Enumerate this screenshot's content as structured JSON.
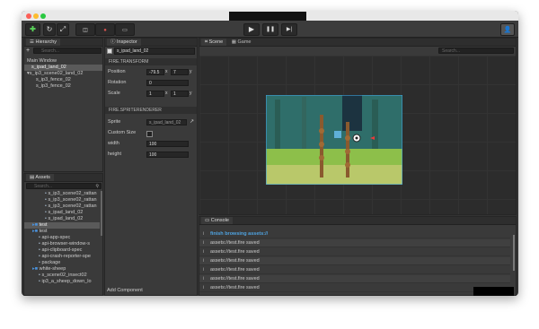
{
  "toolbar": {
    "play_icon": "▶",
    "pause_icon": "❚❚",
    "step_icon": "▶|"
  },
  "hierarchy": {
    "title": "Hierarchy",
    "search_placeholder": "Search...",
    "items": [
      {
        "label": "Main Window",
        "indent": 0
      },
      {
        "label": "s_ipad_land_02",
        "indent": 1,
        "selected": true
      },
      {
        "label": "s_ip3_scene02_land_02",
        "indent": 1,
        "expanded": true
      },
      {
        "label": "s_ip3_fence_02",
        "indent": 2
      },
      {
        "label": "s_ip3_fence_02",
        "indent": 2
      }
    ]
  },
  "inspector": {
    "title": "Inspector",
    "node_name": "s_ipad_land_02",
    "transform_header": "FIRE.TRANSFORM",
    "position_label": "Position",
    "position_x": "-79.5",
    "position_y": "7",
    "x_axis": "x",
    "y_axis": "y",
    "rotation_label": "Rotation",
    "rotation_value": "0",
    "scale_label": "Scale",
    "scale_x": "1",
    "scale_y": "1",
    "sprite_header": "FIRE.SPRITERENDERER",
    "sprite_label": "Sprite",
    "sprite_value": "s_ipad_land_02",
    "custom_size_label": "Custom Size",
    "width_label": "width",
    "width_value": "100",
    "height_label": "height",
    "height_value": "100",
    "add_component": "Add Component"
  },
  "scene": {
    "tab_scene": "Scene",
    "tab_game": "Game",
    "search_placeholder": "Search..."
  },
  "assets": {
    "title": "Assets",
    "search_placeholder": "Search...",
    "items": [
      {
        "label": "s_ip3_scene02_rattan",
        "indent": 3
      },
      {
        "label": "s_ip3_scene02_rattan",
        "indent": 3
      },
      {
        "label": "s_ip3_scene02_rattan",
        "indent": 3
      },
      {
        "label": "s_ipad_land_02",
        "indent": 3
      },
      {
        "label": "s_ipad_land_02",
        "indent": 3
      },
      {
        "label": "test",
        "indent": 1,
        "selected": true
      },
      {
        "label": "test",
        "indent": 1
      },
      {
        "label": "api-app-spec",
        "indent": 2
      },
      {
        "label": "api-browser-window-s",
        "indent": 2
      },
      {
        "label": "api-clipboard-spec",
        "indent": 2
      },
      {
        "label": "api-crash-reporter-spe",
        "indent": 2
      },
      {
        "label": "package",
        "indent": 2
      },
      {
        "label": "white-sheep",
        "indent": 1
      },
      {
        "label": "s_scene02_insect02",
        "indent": 2
      },
      {
        "label": "ip3_a_sheep_down_lo",
        "indent": 2
      }
    ]
  },
  "console": {
    "title": "Console",
    "rows": [
      {
        "text": "finish browsing assets://",
        "highlight": true
      },
      {
        "text": "assets://test.fire saved"
      },
      {
        "text": "assets://test.fire saved"
      },
      {
        "text": "assets://test.fire saved"
      },
      {
        "text": "assets://test.fire saved"
      },
      {
        "text": "assets://test.fire saved"
      },
      {
        "text": "assets://test.fire saved"
      }
    ]
  },
  "colors": {
    "accent": "#3e9fd8",
    "highlight_text": "#4fa3e0",
    "window_bg": "#333333"
  }
}
